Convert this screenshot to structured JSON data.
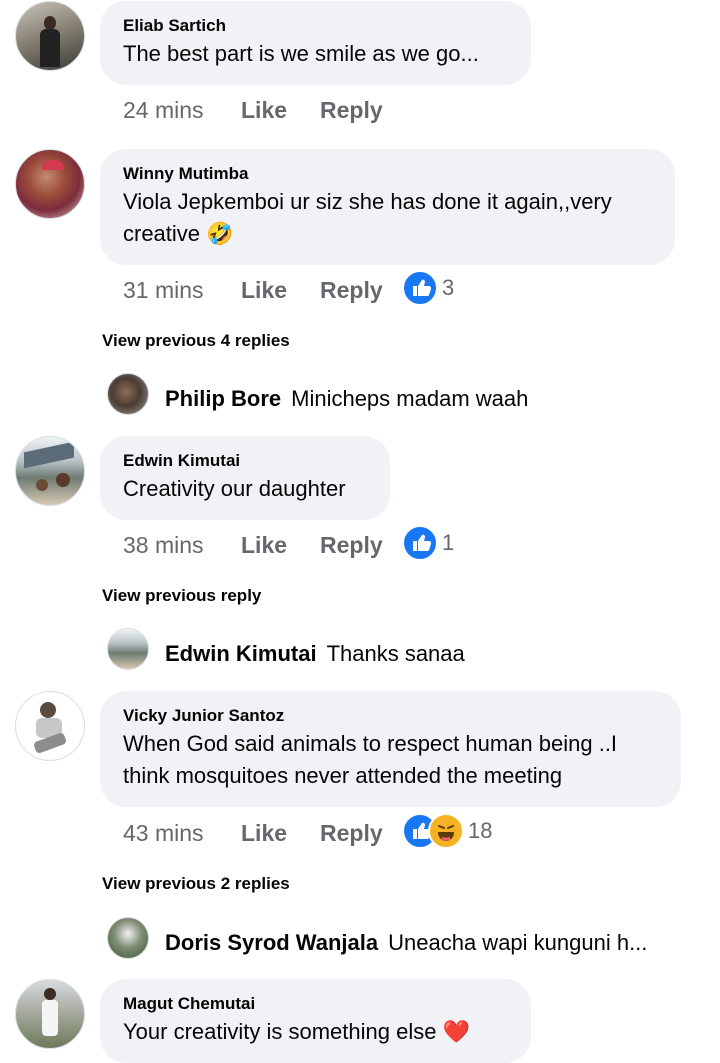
{
  "comments": [
    {
      "author": "Eliab Sartich",
      "text": "The best part is we smile as we go...",
      "time": "24 mins",
      "like": "Like",
      "reply": "Reply"
    },
    {
      "author": "Winny Mutimba",
      "text_line1": "Viola Jepkemboi ur siz she has done it again,,very",
      "text_line2": "creative",
      "emoji": "🤣",
      "time": "31 mins",
      "like": "Like",
      "reply": "Reply",
      "reaction_icons": [
        "like-icon"
      ],
      "reaction_count": "3"
    },
    {
      "author": "Edwin Kimutai",
      "text": "Creativity our daughter",
      "time": "38 mins",
      "like": "Like",
      "reply": "Reply",
      "reaction_icons": [
        "like-icon"
      ],
      "reaction_count": "1"
    },
    {
      "author": "Vicky Junior Santoz",
      "text_line1": "When God said animals to respect human being ..I",
      "text_line2": "think mosquitoes never attended the meeting",
      "time": "43 mins",
      "like": "Like",
      "reply": "Reply",
      "reaction_icons": [
        "like-icon",
        "haha-icon"
      ],
      "reaction_count": "18"
    },
    {
      "author": "Magut Chemutai",
      "text": "Your creativity is something else",
      "emoji": "❤️"
    }
  ],
  "view_previous": [
    "View previous 4 replies",
    "View previous reply",
    "View previous 2 replies"
  ],
  "replies": [
    {
      "author": "Philip Bore",
      "text": "Minicheps madam waah"
    },
    {
      "author": "Edwin Kimutai",
      "text": "Thanks sanaa"
    },
    {
      "author": "Doris Syrod Wanjala",
      "text": "Uneacha wapi kunguni h..."
    }
  ],
  "colors": {
    "bubble": "#f0f2f5",
    "meta": "#65676b",
    "like_blue": "#1877f2",
    "haha_yellow": "#f7b125"
  }
}
